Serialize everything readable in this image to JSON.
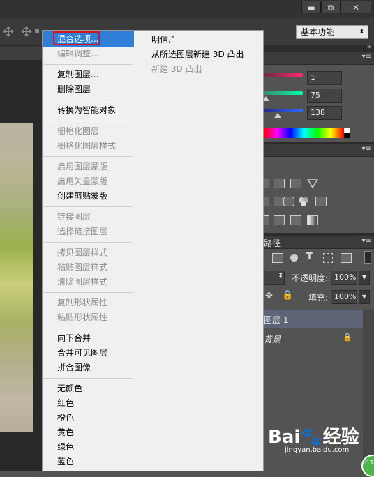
{
  "window_controls": {
    "minimize": "▬",
    "restore": "⧉",
    "close": "✕"
  },
  "workspace": {
    "value": "基本功能",
    "arrow": "⬍"
  },
  "colors": {
    "accent": "#2f7fd6",
    "highlight_box": "#d8141b"
  },
  "color_panel": {
    "r": "1",
    "g": "75",
    "b": "138"
  },
  "layers_panel": {
    "tab_label": "路径",
    "opacity_label": "不透明度:",
    "opacity_value": "100%",
    "fill_label": "填充:",
    "fill_value": "100%",
    "layers": [
      {
        "name": "图层 1"
      },
      {
        "name": "背景"
      }
    ]
  },
  "context_menu": {
    "items": [
      {
        "label": "混合选项...",
        "disabled": false,
        "selected": true
      },
      {
        "label": "编辑调整...",
        "disabled": true
      },
      {
        "label": "复制图层...",
        "disabled": false
      },
      {
        "label": "删除图层",
        "disabled": false
      },
      {
        "label": "转换为智能对象",
        "disabled": false
      },
      {
        "label": "栅格化图层",
        "disabled": true
      },
      {
        "label": "栅格化图层样式",
        "disabled": true
      },
      {
        "label": "启用图层蒙版",
        "disabled": true
      },
      {
        "label": "启用矢量蒙版",
        "disabled": true
      },
      {
        "label": "创建剪贴蒙版",
        "disabled": false
      },
      {
        "label": "链接图层",
        "disabled": true
      },
      {
        "label": "选择链接图层",
        "disabled": true
      },
      {
        "label": "拷贝图层样式",
        "disabled": true
      },
      {
        "label": "粘贴图层样式",
        "disabled": true
      },
      {
        "label": "清除图层样式",
        "disabled": true
      },
      {
        "label": "复制形状属性",
        "disabled": true
      },
      {
        "label": "粘贴形状属性",
        "disabled": true
      },
      {
        "label": "向下合并",
        "disabled": false
      },
      {
        "label": "合并可见图层",
        "disabled": false
      },
      {
        "label": "拼合图像",
        "disabled": false
      },
      {
        "label": "无颜色",
        "disabled": false
      },
      {
        "label": "红色",
        "disabled": false
      },
      {
        "label": "橙色",
        "disabled": false
      },
      {
        "label": "黄色",
        "disabled": false
      },
      {
        "label": "绿色",
        "disabled": false
      },
      {
        "label": "蓝色",
        "disabled": false
      }
    ],
    "secondary": [
      {
        "label": "明信片",
        "disabled": false
      },
      {
        "label": "从所选图层新建 3D 凸出",
        "disabled": false
      },
      {
        "label": "新建 3D 凸出",
        "disabled": true
      }
    ]
  },
  "watermark": {
    "brand": "Bai🐾经验",
    "url": "jingyan.baidu.com",
    "badge": "83"
  }
}
